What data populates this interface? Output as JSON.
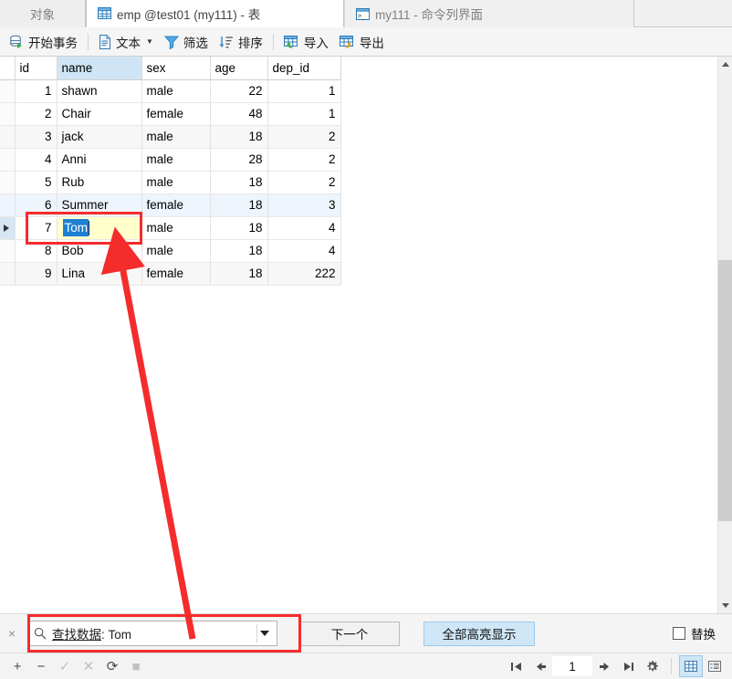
{
  "tabs": [
    {
      "label": "对象",
      "icon": "none",
      "active": false
    },
    {
      "label": "emp @test01 (my111) - 表",
      "icon": "table-icon",
      "active": true
    },
    {
      "label": "my111 - 命令列界面",
      "icon": "console-icon",
      "active": false
    }
  ],
  "toolbar": {
    "begin_transaction": "开始事务",
    "text": "文本",
    "filter": "筛选",
    "sort": "排序",
    "import": "导入",
    "export": "导出"
  },
  "grid": {
    "columns": [
      "id",
      "name",
      "sex",
      "age",
      "dep_id"
    ],
    "selected_column": "name",
    "current_row_index": 6,
    "editing": {
      "row_index": 6,
      "column": "name",
      "value": "Tom",
      "selected": true
    },
    "rows": [
      {
        "id": "1",
        "name": "shawn",
        "sex": "male",
        "age": "22",
        "dep_id": "1",
        "style": "normal"
      },
      {
        "id": "2",
        "name": "Chair",
        "sex": "female",
        "age": "48",
        "dep_id": "1",
        "style": "normal"
      },
      {
        "id": "3",
        "name": "jack",
        "sex": "male",
        "age": "18",
        "dep_id": "2",
        "style": "alt"
      },
      {
        "id": "4",
        "name": "Anni",
        "sex": "male",
        "age": "28",
        "dep_id": "2",
        "style": "normal"
      },
      {
        "id": "5",
        "name": "Rub",
        "sex": "male",
        "age": "18",
        "dep_id": "2",
        "style": "normal"
      },
      {
        "id": "6",
        "name": "Summer",
        "sex": "female",
        "age": "18",
        "dep_id": "3",
        "style": "match"
      },
      {
        "id": "7",
        "name": "Tom",
        "sex": "male",
        "age": "18",
        "dep_id": "4",
        "style": "current"
      },
      {
        "id": "8",
        "name": "Bob",
        "sex": "male",
        "age": "18",
        "dep_id": "4",
        "style": "normal"
      },
      {
        "id": "9",
        "name": "Lina",
        "sex": "female",
        "age": "18",
        "dep_id": "222",
        "style": "alt"
      }
    ]
  },
  "findbar": {
    "close_label": "×",
    "search_icon": "search-icon",
    "prefix": "查找数据",
    "separator": ":",
    "query": "Tom",
    "next_button": "下一个",
    "highlight_all_button": "全部高亮显示",
    "replace_checkbox_label": "替换",
    "replace_checked": false
  },
  "statusbar": {
    "add": "+",
    "remove": "−",
    "confirm": "✓",
    "cancel": "✕",
    "refresh": "⟳",
    "stop": "■",
    "first_page": "first-page-icon",
    "prev_page": "prev-page-icon",
    "page_number": "1",
    "next_page": "next-page-icon",
    "last_page": "last-page-icon",
    "settings": "gear-icon",
    "grid_view": "grid-view-icon",
    "form_view": "form-view-icon",
    "active_view": "grid"
  },
  "annotations": {
    "accent_color": "#f42c2c",
    "cell_highlight_box": "red-rect-around-editing-cell",
    "findbox_highlight_box": "red-rect-around-find-input",
    "arrow": "red-arrow-from-findbox-to-cell"
  },
  "colors": {
    "editing_cell_bg": "#ffffcc",
    "text_selection_bg": "#1e7fd4",
    "selected_column_bg": "#cfe5f5",
    "match_row_bg": "#eef5fc",
    "highlight_button_bg": "#cfe6f7"
  }
}
